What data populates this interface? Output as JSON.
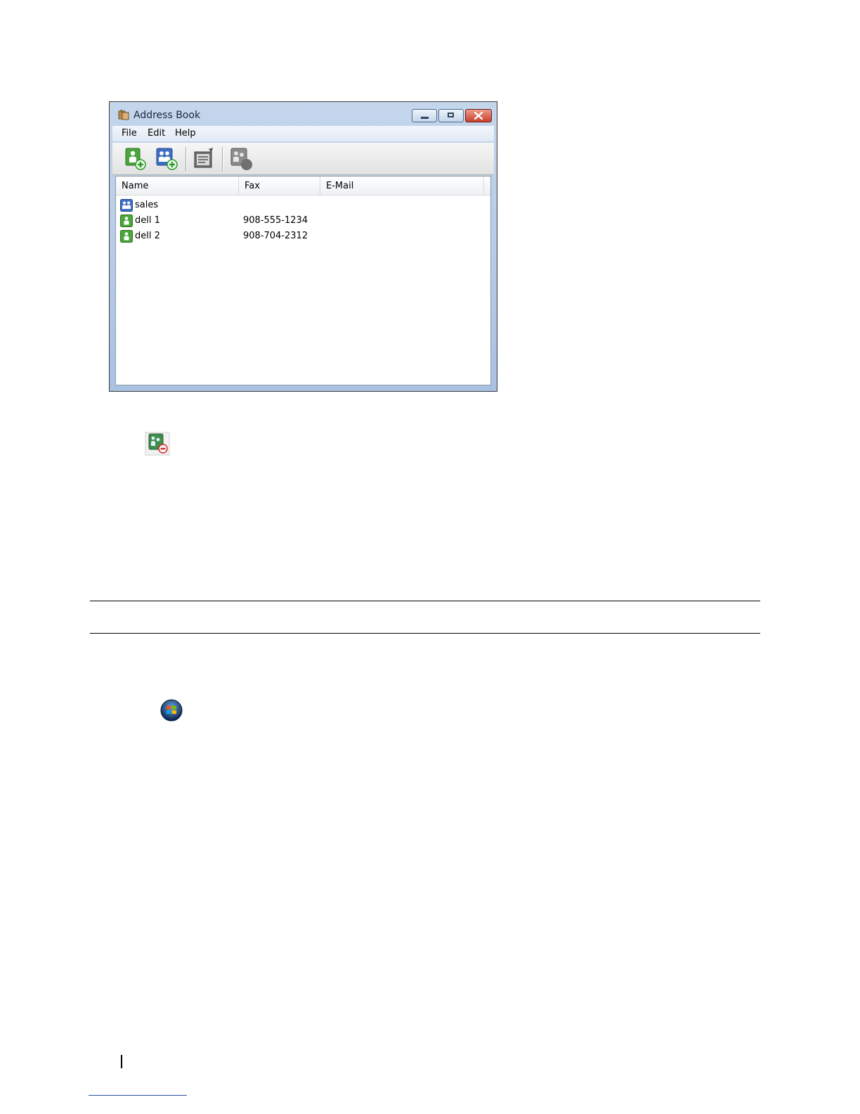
{
  "window": {
    "title": "Address Book",
    "icon": "address-book-icon"
  },
  "menu": {
    "items": [
      "File",
      "Edit",
      "Help"
    ]
  },
  "toolbar": {
    "buttons": [
      {
        "icon": "add-contact-icon"
      },
      {
        "icon": "add-group-icon"
      },
      {
        "icon": "edit-entry-icon"
      },
      {
        "icon": "delete-entry-icon"
      }
    ]
  },
  "list": {
    "columns": [
      "Name",
      "Fax",
      "E-Mail"
    ],
    "rows": [
      {
        "type": "group",
        "icon": "group-icon",
        "name": "sales",
        "fax": "",
        "email": ""
      },
      {
        "type": "contact",
        "icon": "contact-icon",
        "name": "dell 1",
        "fax": "908-555-1234",
        "email": ""
      },
      {
        "type": "contact",
        "icon": "contact-icon",
        "name": "dell 2",
        "fax": "908-704-2312",
        "email": ""
      }
    ]
  },
  "page_icons": {
    "delete_icon": "delete-entry-icon",
    "start_icon": "windows-start-orb-icon"
  },
  "colors": {
    "contact": "#4aa63a",
    "group": "#3f6fc4",
    "add_badge": "#2e9a2e",
    "delete_badge": "#d2282b",
    "close_button": "#c9412b"
  }
}
